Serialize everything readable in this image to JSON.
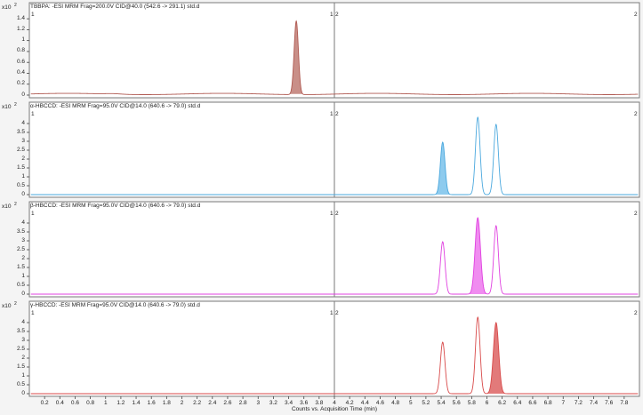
{
  "x_axis": {
    "title": "Counts vs. Acquisition Time (min)",
    "ticks": [
      "0.2",
      "0.4",
      "0.6",
      "0.8",
      "1",
      "1.2",
      "1.4",
      "1.6",
      "1.8",
      "2",
      "2.2",
      "2.4",
      "2.6",
      "2.8",
      "3",
      "3.2",
      "3.4",
      "3.6",
      "3.8",
      "4",
      "4.2",
      "4.4",
      "4.6",
      "4.8",
      "5",
      "5.2",
      "5.4",
      "5.6",
      "5.8",
      "6",
      "6.2",
      "6.4",
      "6.6",
      "6.8",
      "7",
      "7.2",
      "7.4",
      "7.6",
      "7.8"
    ],
    "range": [
      0,
      8
    ]
  },
  "panels": [
    {
      "title": "TBBPA: -ESI MRM Frag=200.0V CID@40.0 (542.6 -> 291.1) std.d",
      "y_scale_label": "x10",
      "y_exponent": "2",
      "y_ticks": [
        "0",
        "0.2",
        "0.4",
        "0.6",
        "0.8",
        "1",
        "1.2",
        "1.4"
      ],
      "y_range": [
        0,
        1.5
      ],
      "seg_left_start": "1",
      "seg_left_end": "1",
      "seg_right_start": "2",
      "seg_right_end": "2",
      "color": "#b05a52",
      "fill_color": "#c98f88"
    },
    {
      "title": "α-HBCCD: -ESI MRM Frag=95.0V CID@14.0 (640.6 -> 79.0) std.d",
      "y_scale_label": "x10",
      "y_exponent": "2",
      "y_ticks": [
        "0",
        "0.5",
        "1",
        "1.5",
        "2",
        "2.5",
        "3",
        "3.5",
        "4"
      ],
      "y_range": [
        0,
        4.6
      ],
      "seg_left_start": "1",
      "seg_left_end": "1",
      "seg_right_start": "2",
      "seg_right_end": "2",
      "color": "#4aa8de",
      "fill_color": "#8ecbee"
    },
    {
      "title": "β-HBCCD: -ESI MRM Frag=95.0V CID@14.0 (640.6 -> 79.0) std.d",
      "y_scale_label": "x10",
      "y_exponent": "2",
      "y_ticks": [
        "0",
        "0.5",
        "1",
        "1.5",
        "2",
        "2.5",
        "3",
        "3.5",
        "4"
      ],
      "y_range": [
        0,
        4.6
      ],
      "seg_left_start": "1",
      "seg_left_end": "1",
      "seg_right_start": "2",
      "seg_right_end": "2",
      "color": "#e040e0",
      "fill_color": "#f08cf0"
    },
    {
      "title": "γ-HBCCD: -ESI MRM Frag=95.0V CID@14.0 (640.6 -> 79.0) std.d",
      "y_scale_label": "x10",
      "y_exponent": "2",
      "y_ticks": [
        "0",
        "0.5",
        "1",
        "1.5",
        "2",
        "2.5",
        "3",
        "3.5",
        "4"
      ],
      "y_range": [
        0,
        4.6
      ],
      "seg_left_start": "1",
      "seg_left_end": "1",
      "seg_right_start": "2",
      "seg_right_end": "2",
      "color": "#d84a4a",
      "fill_color": "#e27a7a"
    }
  ],
  "chart_data": [
    {
      "type": "line",
      "title": "TBBPA: -ESI MRM Frag=200.0V CID@40.0 (542.6 -> 291.1) std.d",
      "xlabel": "Counts vs. Acquisition Time (min)",
      "ylabel": "x10^2",
      "xlim": [
        0,
        8
      ],
      "ylim": [
        0,
        1.5
      ],
      "segment_break": 4.0,
      "baseline": 0.02,
      "peaks": [
        {
          "rt": 3.5,
          "height": 1.35,
          "width": 0.028,
          "filled": true
        }
      ]
    },
    {
      "type": "line",
      "title": "α-HBCCD: -ESI MRM Frag=95.0V CID@14.0 (640.6 -> 79.0) std.d",
      "xlabel": "Counts vs. Acquisition Time (min)",
      "ylabel": "x10^2",
      "xlim": [
        0,
        8
      ],
      "ylim": [
        0,
        4.6
      ],
      "segment_break": 4.0,
      "baseline": 0.0,
      "peaks": [
        {
          "rt": 5.42,
          "height": 2.95,
          "width": 0.03,
          "filled": true
        },
        {
          "rt": 5.88,
          "height": 4.35,
          "width": 0.03,
          "filled": false
        },
        {
          "rt": 6.12,
          "height": 3.95,
          "width": 0.03,
          "filled": false
        }
      ]
    },
    {
      "type": "line",
      "title": "β-HBCCD: -ESI MRM Frag=95.0V CID@14.0 (640.6 -> 79.0) std.d",
      "xlabel": "Counts vs. Acquisition Time (min)",
      "ylabel": "x10^2",
      "xlim": [
        0,
        8
      ],
      "ylim": [
        0,
        4.6
      ],
      "segment_break": 4.0,
      "baseline": 0.0,
      "peaks": [
        {
          "rt": 5.42,
          "height": 2.95,
          "width": 0.03,
          "filled": false
        },
        {
          "rt": 5.88,
          "height": 4.3,
          "width": 0.035,
          "filled": true
        },
        {
          "rt": 6.12,
          "height": 3.85,
          "width": 0.03,
          "filled": false
        }
      ]
    },
    {
      "type": "line",
      "title": "γ-HBCCD: -ESI MRM Frag=95.0V CID@14.0 (640.6 -> 79.0) std.d",
      "xlabel": "Counts vs. Acquisition Time (min)",
      "ylabel": "x10^2",
      "xlim": [
        0,
        8
      ],
      "ylim": [
        0,
        4.6
      ],
      "segment_break": 4.0,
      "baseline": 0.0,
      "peaks": [
        {
          "rt": 5.42,
          "height": 2.9,
          "width": 0.03,
          "filled": false
        },
        {
          "rt": 5.88,
          "height": 4.3,
          "width": 0.03,
          "filled": false
        },
        {
          "rt": 6.12,
          "height": 4.0,
          "width": 0.035,
          "filled": true
        }
      ]
    }
  ]
}
